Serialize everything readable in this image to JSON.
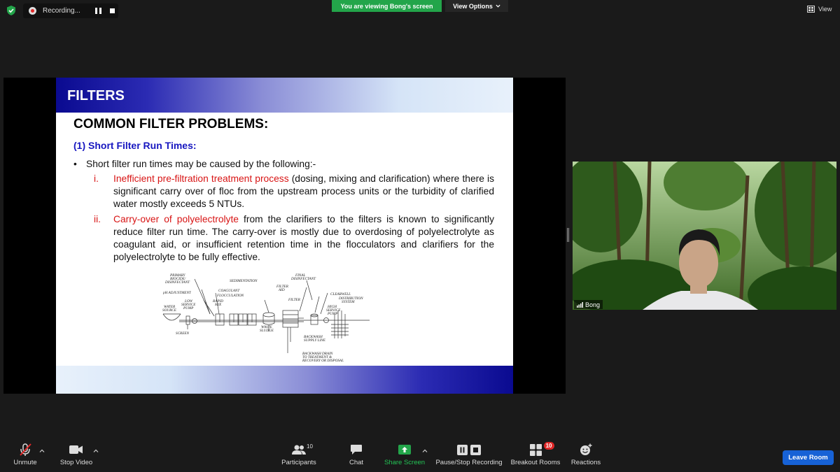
{
  "top_bar": {
    "recording_label": "Recording...",
    "viewing_banner": "You are viewing Bong's screen",
    "view_options_label": "View Options",
    "view_label": "View"
  },
  "slide": {
    "title": "FILTERS",
    "heading": "COMMON FILTER PROBLEMS:",
    "subheading": "(1) Short Filter Run Times:",
    "bullet": "Short filter run times may be caused by the following:-",
    "items": [
      {
        "num": "i.",
        "highlight": "Inefficient pre-filtration treatment process",
        "rest": " (dosing, mixing and clarification) where there is significant carry over of floc from the upstream process units or the turbidity of clarified water mostly exceeds 5 NTUs."
      },
      {
        "num": "ii.",
        "highlight": "Carry-over of polyelectrolyte",
        "rest": " from the clarifiers to the filters is known to significantly reduce filter run time. The carry-over is mostly due to overdosing of polyelectrolyte as coagulant aid, or insufficient retention time in the flocculators and clarifiers for the polyelectrolyte to be fully effective."
      }
    ],
    "diagram_labels": {
      "primary": "PRIMARY",
      "biocide": "BIOCIDE/",
      "disinfectant": "DISINFECTANT",
      "ph": "pH ADJUSTMENT",
      "low": "LOW",
      "service": "SERVICE",
      "pump": "PUMP",
      "coagulant": "COAGULANT",
      "flocculation": "FLOCCULATION",
      "rapid": "RAPID",
      "mix": "MIX",
      "water": "WATER",
      "source": "SOURCE",
      "screen": "SCREEN",
      "sedimentation": "SEDIMENTATION",
      "filter": "FILTER",
      "aid": "AID",
      "final": "FINAL",
      "final_disinfectant": "DISINFECTANT",
      "filter2": "FILTER",
      "clearwell": "CLEARWELL",
      "distribution": "DISTRIBUTION",
      "system": "SYSTEM",
      "high": "HIGH",
      "high_service": "SERVICE",
      "high_pump": "PUMP",
      "waste": "WASTE",
      "sludge": "SLUDGE",
      "backwash": "BACKWASH",
      "supply_line": "SUPPLY LINE",
      "backwash_drain": "BACKWASH DRAIN",
      "to_treatment": "TO TREATMENT &",
      "recovery": "RECOVERY OR DISPOSAL"
    }
  },
  "webcam": {
    "name": "Bong"
  },
  "toolbar": {
    "unmute": "Unmute",
    "stop_video": "Stop Video",
    "participants": "Participants",
    "participants_count": "10",
    "chat": "Chat",
    "share_screen": "Share Screen",
    "pause_stop_recording": "Pause/Stop Recording",
    "breakout_rooms": "Breakout Rooms",
    "breakout_badge": "10",
    "reactions": "Reactions",
    "leave_room": "Leave Room"
  },
  "colors": {
    "share_green": "#23a54a",
    "leave_blue": "#1762d6",
    "slide_blue": "#1717c0",
    "slide_red": "#d81414"
  }
}
